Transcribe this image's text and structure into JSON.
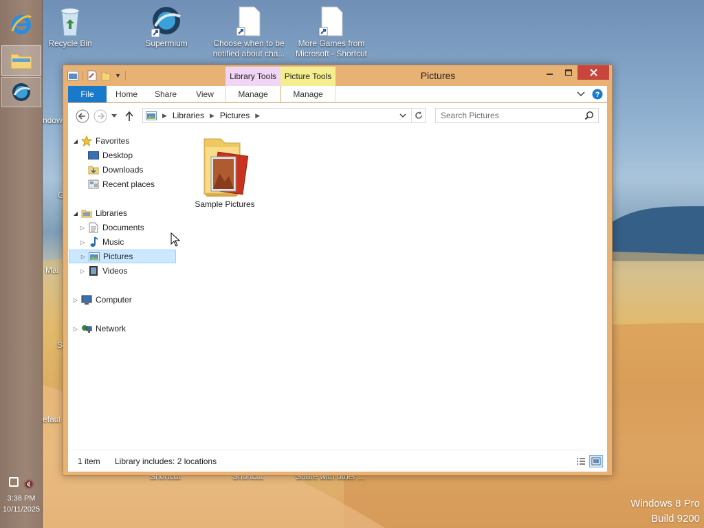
{
  "desktop": {
    "icons": [
      {
        "label": "Recycle Bin",
        "icon": "recycle-bin-icon"
      },
      {
        "label": "Supermium",
        "icon": "supermium-icon"
      },
      {
        "label": "Choose when to be notified about cha...",
        "icon": "shortcut-file-icon"
      },
      {
        "label": "More Games from Microsoft - Shortcut",
        "icon": "shortcut-file-icon"
      }
    ],
    "partial_labels": [
      "ndow",
      "G",
      "Mai",
      "S",
      "efaul",
      "Shortcut",
      "Shortcut",
      "Share with other ..."
    ],
    "watermark": {
      "line1": "Windows 8 Pro",
      "line2": "Build 9200"
    }
  },
  "taskbar": {
    "buttons": [
      {
        "name": "internet-explorer",
        "icon": "internet-explorer-icon"
      },
      {
        "name": "file-explorer",
        "icon": "file-explorer-icon",
        "state": "active"
      },
      {
        "name": "supermium",
        "icon": "supermium-icon",
        "state": "pressed"
      }
    ],
    "tray": {
      "time": "3:38 PM",
      "date": "10/11/2025",
      "icons": [
        "network-icon",
        "volume-muted-icon"
      ]
    }
  },
  "window": {
    "title": "Pictures",
    "context_tabs": [
      {
        "label": "Library Tools",
        "color": "#f0d5f5"
      },
      {
        "label": "Picture Tools",
        "color": "#f4ee8f"
      }
    ],
    "ribbon_tabs": [
      {
        "label": "File",
        "active": true
      },
      {
        "label": "Home"
      },
      {
        "label": "Share"
      },
      {
        "label": "View"
      },
      {
        "label": "Manage"
      },
      {
        "label": "Manage"
      }
    ],
    "controls": {
      "minimize": "minimize",
      "maximize": "maximize",
      "close": "close"
    },
    "address": {
      "crumbs": [
        "Libraries",
        "Pictures"
      ]
    },
    "search": {
      "placeholder": "Search Pictures"
    },
    "nav_pane": {
      "favorites": {
        "label": "Favorites",
        "items": [
          "Desktop",
          "Downloads",
          "Recent places"
        ]
      },
      "libraries": {
        "label": "Libraries",
        "items": [
          "Documents",
          "Music",
          "Pictures",
          "Videos"
        ],
        "selected": "Pictures"
      },
      "computer": "Computer",
      "network": "Network"
    },
    "files": [
      {
        "label": "Sample Pictures",
        "icon": "picture-folder-icon"
      }
    ],
    "status": {
      "count": "1 item",
      "library": "Library includes: 2 locations"
    },
    "accent": "#1979ca",
    "frame_color": "#e9b275"
  }
}
